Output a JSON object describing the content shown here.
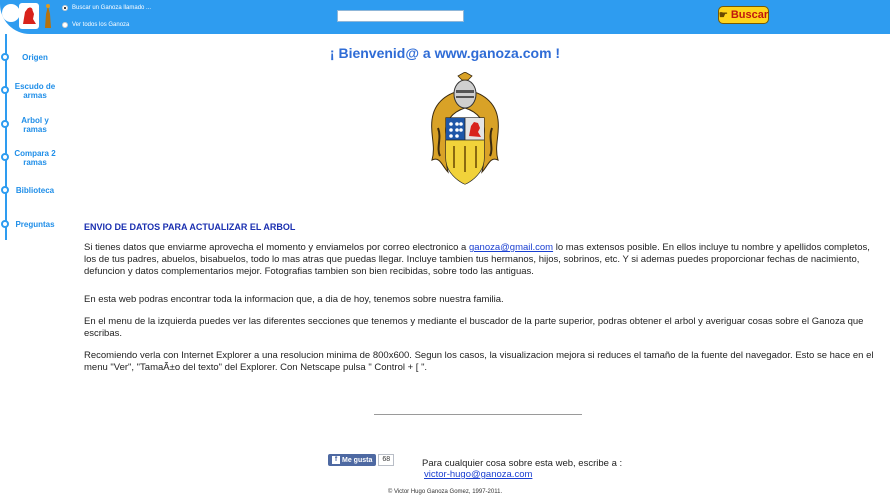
{
  "header": {
    "radio_search_label": "Buscar un Ganoza llamado ...",
    "radio_all_label": "Ver todos los Ganoza",
    "search_placeholder": "",
    "search_button_label": "Buscar"
  },
  "sidebar": {
    "items": [
      {
        "label": "Origen"
      },
      {
        "label": "Escudo de armas"
      },
      {
        "label": "Arbol y ramas"
      },
      {
        "label": "Compara 2 ramas"
      },
      {
        "label": "Biblioteca"
      },
      {
        "label": "Preguntas"
      }
    ]
  },
  "main": {
    "welcome": "¡ Bienvenid@ a www.ganoza.com !",
    "section_title": "ENVIO DE DATOS PARA ACTUALIZAR EL ARBOL",
    "para1_before": "Si tienes datos que enviarme aprovecha el momento y enviamelos por correo electronico a ",
    "para1_email": "ganoza@gmail.com",
    "para1_after": "  lo mas extensos posible. En ellos incluye tu nombre y apellidos completos, los de tus padres, abuelos, bisabuelos, todo lo mas atras que puedas llegar. Incluye tambien tus hermanos, hijos, sobrinos, etc. Y si ademas puedes proporcionar fechas de nacimiento, defuncion y datos complementarios mejor. Fotografias tambien son bien recibidas, sobre todo las antiguas.",
    "para2": "En esta web podras encontrar toda la informacion que, a dia de hoy, tenemos sobre nuestra familia.",
    "para3": "En el menu de la izquierda puedes ver las diferentes secciones que tenemos y mediante el buscador de la parte superior, podras obtener el arbol y averiguar cosas sobre el Ganoza que escribas.",
    "para4": "Recomiendo verla con Internet Explorer a una resolucion minima de 800x600. Segun los casos, la visualizacion mejora si reduces el tamaño de la fuente del navegador. Esto se hace en el menu \"Ver\", \"TamaÃ±o del texto\" del Explorer. Con Netscape pulsa \" Control + [ \"."
  },
  "footer": {
    "fb_like_label": "Me gusta",
    "fb_count": "68",
    "contact_text": "Para cualquier cosa sobre esta web, escribe a :",
    "contact_email": "victor-hugo@ganoza.com",
    "copyright": "© Victor Hugo Ganoza Gomez, 1997-2011."
  },
  "colors": {
    "topbar": "#2e9cf0",
    "nav_text": "#1f8ee8",
    "title": "#2f6cd6",
    "section_title": "#1a2fb0",
    "search_button_bg": "#ffd41a",
    "search_button_text": "#c0170f"
  }
}
